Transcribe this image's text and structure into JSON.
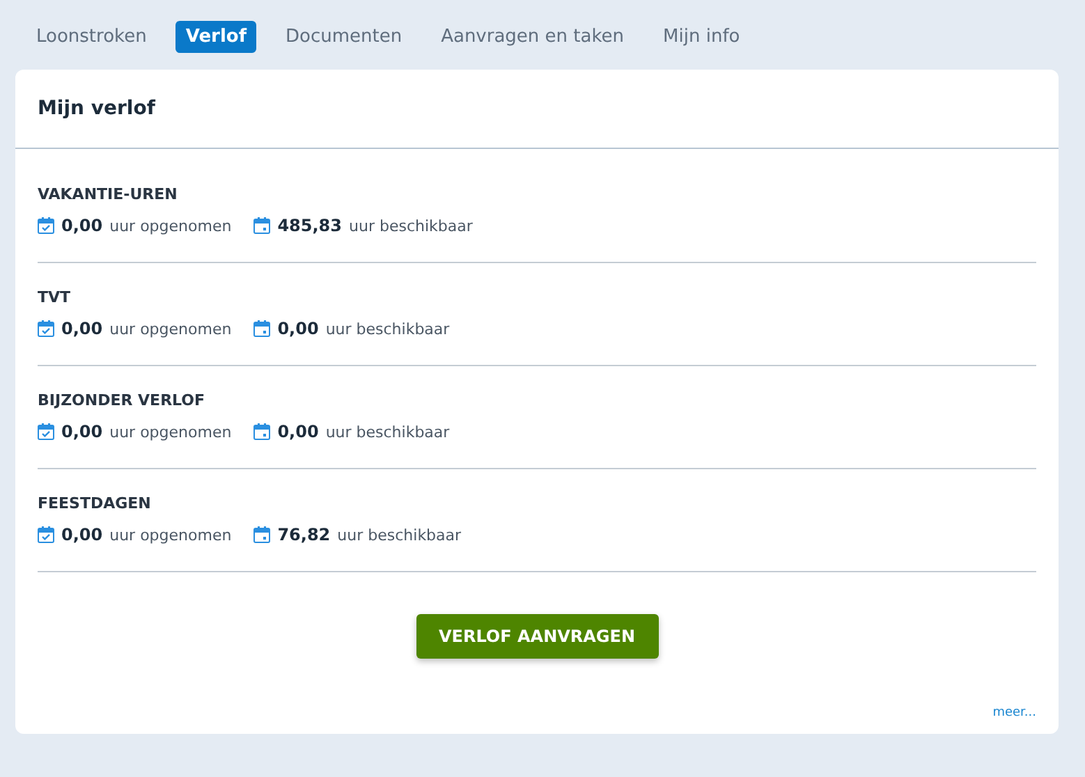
{
  "tabs": [
    {
      "label": "Loonstroken",
      "selected": false
    },
    {
      "label": "Verlof",
      "selected": true
    },
    {
      "label": "Documenten",
      "selected": false
    },
    {
      "label": "Aanvragen en taken",
      "selected": false
    },
    {
      "label": "Mijn info",
      "selected": false
    }
  ],
  "card": {
    "title": "Mijn verlof",
    "categories": [
      {
        "name": "VAKANTIE-UREN",
        "stats": [
          {
            "kind": "taken",
            "value": "0,00",
            "unit": "uur opgenomen"
          },
          {
            "kind": "available",
            "value": "485,83",
            "unit": "uur beschikbaar"
          }
        ]
      },
      {
        "name": "TVT",
        "stats": [
          {
            "kind": "taken",
            "value": "0,00",
            "unit": "uur opgenomen"
          },
          {
            "kind": "available",
            "value": "0,00",
            "unit": "uur beschikbaar"
          }
        ]
      },
      {
        "name": "BIJZONDER VERLOF",
        "stats": [
          {
            "kind": "taken",
            "value": "0,00",
            "unit": "uur opgenomen"
          },
          {
            "kind": "available",
            "value": "0,00",
            "unit": "uur beschikbaar"
          }
        ]
      },
      {
        "name": "FEESTDAGEN",
        "stats": [
          {
            "kind": "taken",
            "value": "0,00",
            "unit": "uur opgenomen"
          },
          {
            "kind": "available",
            "value": "76,82",
            "unit": "uur beschikbaar"
          }
        ]
      }
    ],
    "button": "VERLOF AANVRAGEN",
    "more_link": "meer..."
  }
}
